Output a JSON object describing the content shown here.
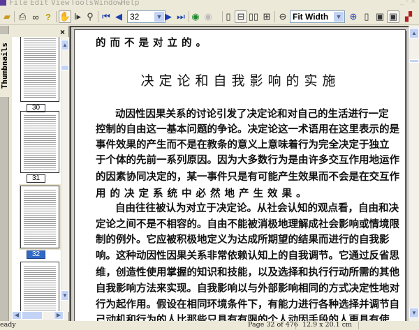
{
  "menu": [
    "File",
    "Edit",
    "View",
    "Tools",
    "Window",
    "Help"
  ],
  "toolbar": {
    "page_number": "32",
    "zoom": "Fit Width"
  },
  "panel": {
    "tab_label": "Thumbnails",
    "close": "×",
    "thumbnail_labels": [
      "30",
      "31",
      "32"
    ],
    "current": "32"
  },
  "document": {
    "first_line": "的而不是对立的。",
    "title": "决定论和自我影响的实施",
    "lines": [
      "动因性因果关系的讨论引发了决定论和对自己的生活进行一定",
      "控制的自由这一基本问题的争论。决定论这一术语用在这里表示的是",
      "事件效果的产生而不是在教条的意义上意味着行为完全决定于独立",
      "于个体的先前一系列原因。因为大多数行为是由许多交互作用地运作",
      "的因素协同决定的，某一事件只是有可能产生效果而不会是在交互作",
      "用的决定系统中必然地产生效果。",
      "自由往往被认为对立于决定论。从社会认知的观点看，自由和决",
      "定论之间不是不相容的。自由不能被消极地理解成社会影响或情境限",
      "制的例外。它应被积极地定义为达成所期望的结果而进行的自我影",
      "响。这种动因性因果关系非常依赖认知上的自我调节。它通过反省思",
      "维，创造性使用掌握的知识和技能，以及选择和执行行动所需的其他",
      "自我影响方法来实现。自我影响以与外部影响相同的方式决定性地对",
      "行为起作用。假设在相同环境条件下，有能力进行各种选择并调节自",
      "己动机和行为的人比那些只具有有限的个人动因手段的人更具有使"
    ]
  },
  "status": {
    "ready": "eady",
    "page": "Page 32 of 476",
    "size": "12.9 x 20.1 cm"
  }
}
